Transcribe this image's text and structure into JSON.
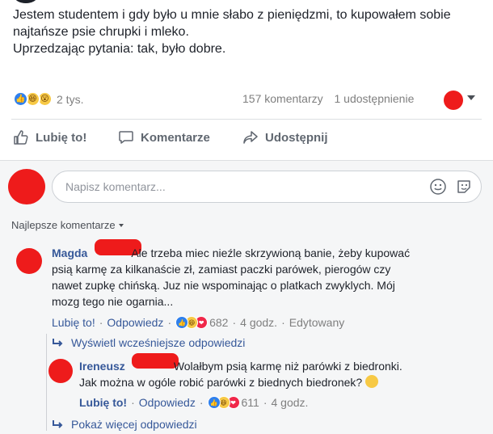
{
  "post": {
    "lines": [
      "Jestem studentem i gdy było u mnie słabo z pieniędzmi, to kupowałem sobie",
      "najtańsze psie chrupki i mleko.",
      "Uprzedzając pytania: tak, było dobre."
    ]
  },
  "stats": {
    "reactions_count": "2 tys.",
    "comments_count": "157 komentarzy",
    "shares_count": "1 udostępnienie"
  },
  "actions": {
    "like": "Lubię to!",
    "comment": "Komentarze",
    "share": "Udostępnij"
  },
  "composer": {
    "placeholder": "Napisz komentarz..."
  },
  "comments_sort": "Najlepsze komentarze",
  "comments": [
    {
      "author": "Magda",
      "lines": [
        "Ale trzeba miec nieźle skrzywioną banie, żeby kupować",
        "psią karmę za kilkanaście zł, zamiast paczki parówek, pierogów czy",
        "nawet zupkę chińską. Juz nie wspominając o platkach zwyklych. Mój",
        "mozg tego nie ogarnia..."
      ],
      "like": "Lubię to!",
      "reply": "Odpowiedz",
      "reactions": "682",
      "time": "4 godz.",
      "edited": "Edytowany"
    }
  ],
  "show_previous_replies": "Wyświetl wcześniejsze odpowiedzi",
  "reply": {
    "author": "Ireneusz",
    "lines": [
      "Wolałbym psią karmę niż parówki z biedronki.",
      "Jak można w ogóle robić parówki z biednych biedronek?"
    ],
    "like": "Lubię to!",
    "reply": "Odpowiedz",
    "reactions": "611",
    "time": "4 godz."
  },
  "show_more_replies": "Pokaż więcej odpowiedzi",
  "colors": {
    "accent": "#365899",
    "redaction": "#ee1b1b",
    "muted": "#7f7f7f"
  }
}
